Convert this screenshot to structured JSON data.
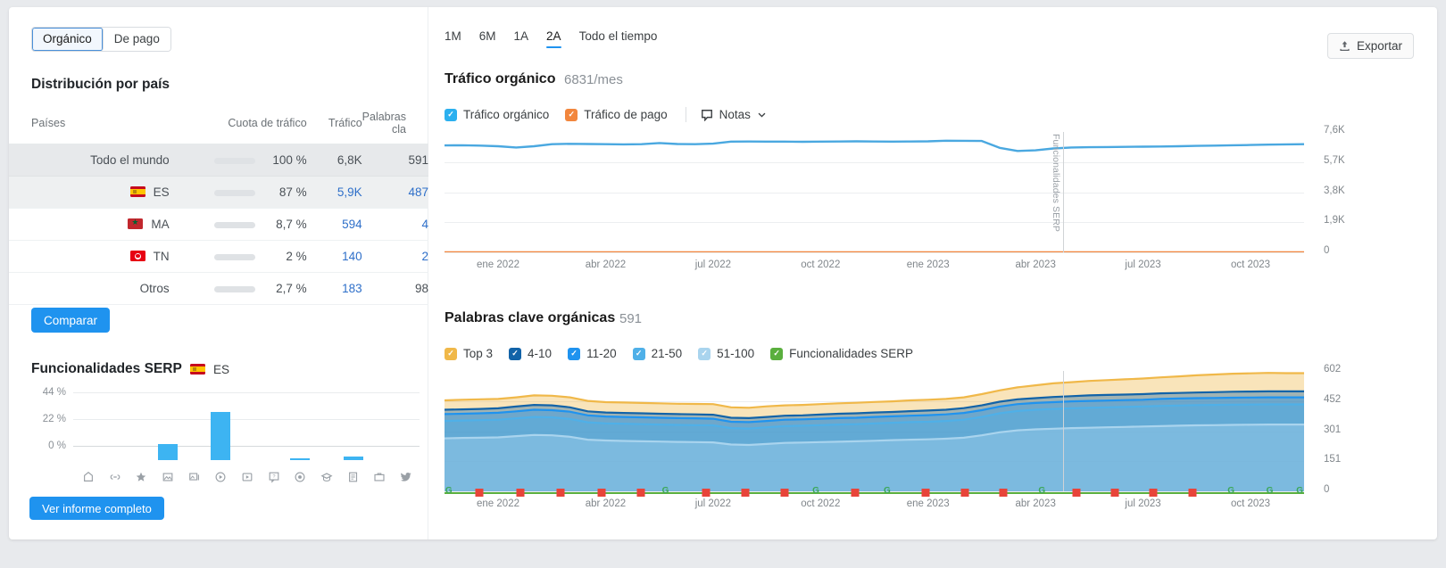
{
  "left_panel": {
    "segmented": {
      "options": [
        {
          "label": "Orgánico",
          "active": true
        },
        {
          "label": "De pago",
          "active": false
        }
      ]
    },
    "distribution": {
      "title": "Distribución por país",
      "columns": [
        "Países",
        "Cuota de tráfico",
        "Tráfico",
        "Palabras cla"
      ],
      "rows": [
        {
          "country": "Todo el mundo",
          "flag": null,
          "share_pct": 100,
          "pct_label": "100 %",
          "traffic": "6,8K",
          "keywords": "591",
          "highlight": "strong"
        },
        {
          "country": "ES",
          "flag": "flag-es",
          "share_pct": 87,
          "pct_label": "87 %",
          "traffic": "5,9K",
          "keywords": "487",
          "highlight": "soft"
        },
        {
          "country": "MA",
          "flag": "flag-ma",
          "share_pct": 8.7,
          "pct_label": "8,7 %",
          "traffic": "594",
          "keywords": "4",
          "highlight": "none"
        },
        {
          "country": "TN",
          "flag": "flag-tn",
          "share_pct": 2,
          "pct_label": "2 %",
          "traffic": "140",
          "keywords": "2",
          "highlight": "none"
        },
        {
          "country": "Otros",
          "flag": null,
          "share_pct": 2.7,
          "pct_label": "2,7 %",
          "traffic": "183",
          "keywords": "98",
          "highlight": "none"
        }
      ]
    },
    "compare_button": "Comparar",
    "serp": {
      "title": "Funcionalidades SERP",
      "country": "ES",
      "full_report_button": "Ver informe completo"
    }
  },
  "right_panel": {
    "periods": [
      {
        "label": "1M",
        "active": false
      },
      {
        "label": "6M",
        "active": false
      },
      {
        "label": "1A",
        "active": false
      },
      {
        "label": "2A",
        "active": true
      },
      {
        "label": "Todo el tiempo",
        "active": false
      }
    ],
    "export_button": "Exportar",
    "traffic": {
      "title": "Tráfico orgánico",
      "subtitle": "6831/mes",
      "legend": [
        {
          "label": "Tráfico orgánico",
          "color": "#2bb0ef",
          "checked": true
        },
        {
          "label": "Tráfico de pago",
          "color": "#f2863d",
          "checked": true
        }
      ],
      "notes_label": "Notas",
      "annotation": "Funcionalidades SERP"
    },
    "keywords": {
      "title": "Palabras clave orgánicas",
      "subtitle": "591",
      "legend": [
        {
          "label": "Top 3",
          "color": "#f0b849",
          "checked": true
        },
        {
          "label": "4-10",
          "color": "#1263a8",
          "checked": true
        },
        {
          "label": "11-20",
          "color": "#1f93ef",
          "checked": true
        },
        {
          "label": "21-50",
          "color": "#4fb0e8",
          "checked": true
        },
        {
          "label": "51-100",
          "color": "#a9d4ee",
          "checked": true
        },
        {
          "label": "Funcionalidades SERP",
          "color": "#5aaf3e",
          "checked": true
        }
      ]
    }
  },
  "chart_data": [
    {
      "type": "bar",
      "id": "serp-features",
      "title": "Funcionalidades SERP",
      "xlabel": "",
      "ylabel": "",
      "ylim": [
        0,
        44
      ],
      "ytick_labels": [
        "44 %",
        "22 %",
        "0 %"
      ],
      "yticks": [
        44,
        22,
        0
      ],
      "categories": [
        "featured-snippet-icon",
        "sitelinks-icon",
        "reviews-icon",
        "image-pack-icon",
        "image-carousel-icon",
        "video-icon",
        "video-carousel-icon",
        "faq-icon",
        "local-pack-icon",
        "knowledge-panel-icon",
        "related-questions-icon",
        "jobs-icon",
        "twitter-icon"
      ],
      "values": [
        0,
        0,
        0,
        13,
        0,
        38,
        0,
        0,
        1.5,
        0,
        3,
        0,
        0
      ],
      "color": "#3db4f2"
    },
    {
      "type": "line",
      "id": "organic-traffic",
      "title": "Tráfico orgánico",
      "subtitle": "6831/mes",
      "xlabel": "",
      "ylabel": "",
      "ylim": [
        0,
        7600
      ],
      "ytick_labels": [
        "7,6K",
        "5,7K",
        "3,8K",
        "1,9K",
        "0"
      ],
      "yticks": [
        7600,
        5700,
        3800,
        1900,
        0
      ],
      "xtick_labels": [
        "ene 2022",
        "abr 2022",
        "jul 2022",
        "oct 2022",
        "ene 2023",
        "abr 2023",
        "jul 2023",
        "oct 2023"
      ],
      "grid": true,
      "legend_position": "top",
      "series": [
        {
          "name": "Tráfico orgánico",
          "color": "#4aa8e0",
          "values": [
            6750,
            6760,
            6740,
            6700,
            6620,
            6700,
            6830,
            6850,
            6840,
            6830,
            6820,
            6830,
            6900,
            6840,
            6830,
            6860,
            6990,
            7000,
            6990,
            6990,
            6980,
            6990,
            7000,
            7010,
            7000,
            6990,
            7000,
            7010,
            7050,
            7040,
            7030,
            6600,
            6400,
            6440,
            6560,
            6620,
            6640,
            6650,
            6660,
            6670,
            6680,
            6700,
            6720,
            6740,
            6760,
            6780,
            6800,
            6820,
            6831
          ]
        },
        {
          "name": "Tráfico de pago",
          "color": "#f2863d",
          "values": [
            0,
            0,
            0,
            0,
            0,
            0,
            0,
            0,
            0,
            0,
            0,
            0,
            0,
            0,
            0,
            0,
            0,
            0,
            0,
            0,
            0,
            0,
            0,
            0,
            0,
            0,
            0,
            0,
            0,
            0,
            0,
            0,
            0,
            0,
            0,
            0,
            0,
            0,
            0,
            0,
            0,
            0,
            0,
            0,
            0,
            0,
            0,
            0,
            0
          ]
        }
      ]
    },
    {
      "type": "area",
      "id": "organic-keywords",
      "title": "Palabras clave orgánicas",
      "subtitle": "591",
      "xlabel": "",
      "ylabel": "",
      "ylim": [
        0,
        602
      ],
      "ytick_labels": [
        "602",
        "452",
        "301",
        "151",
        "0"
      ],
      "yticks": [
        602,
        452,
        301,
        151,
        0
      ],
      "xtick_labels": [
        "ene 2022",
        "abr 2022",
        "jul 2022",
        "oct 2022",
        "ene 2023",
        "abr 2023",
        "jul 2023",
        "oct 2023"
      ],
      "grid": true,
      "legend_position": "top",
      "stacked": true,
      "series": [
        {
          "name": "Top 3",
          "color": "#f0b849",
          "values": [
            455,
            458,
            460,
            462,
            470,
            480,
            478,
            470,
            452,
            446,
            444,
            442,
            440,
            438,
            437,
            436,
            420,
            418,
            425,
            430,
            432,
            436,
            440,
            443,
            447,
            450,
            455,
            458,
            462,
            470,
            486,
            505,
            520,
            530,
            540,
            546,
            552,
            556,
            560,
            564,
            570,
            575,
            580,
            584,
            588,
            590,
            592,
            591,
            591
          ]
        },
        {
          "name": "4-10",
          "color": "#1263a8",
          "values": [
            408,
            410,
            412,
            415,
            424,
            432,
            430,
            420,
            400,
            394,
            392,
            390,
            388,
            386,
            385,
            383,
            368,
            366,
            372,
            378,
            380,
            384,
            388,
            390,
            394,
            397,
            401,
            404,
            408,
            416,
            430,
            448,
            460,
            466,
            472,
            476,
            480,
            482,
            484,
            486,
            490,
            492,
            494,
            496,
            498,
            499,
            500,
            500,
            500
          ]
        },
        {
          "name": "11-20",
          "color": "#1f93ef",
          "values": [
            386,
            388,
            390,
            393,
            400,
            408,
            406,
            398,
            380,
            374,
            372,
            370,
            368,
            366,
            365,
            363,
            348,
            346,
            352,
            358,
            360,
            363,
            366,
            368,
            372,
            375,
            378,
            381,
            385,
            392,
            406,
            424,
            436,
            442,
            446,
            450,
            452,
            454,
            456,
            458,
            462,
            464,
            466,
            467,
            468,
            469,
            470,
            470,
            470
          ]
        },
        {
          "name": "21-50",
          "color": "#4fb0e8",
          "values": [
            352,
            354,
            356,
            358,
            365,
            372,
            370,
            362,
            345,
            340,
            338,
            336,
            334,
            332,
            331,
            330,
            316,
            314,
            320,
            326,
            328,
            331,
            334,
            336,
            340,
            343,
            346,
            348,
            352,
            358,
            372,
            390,
            402,
            408,
            412,
            415,
            418,
            420,
            422,
            424,
            427,
            429,
            431,
            432,
            433,
            434,
            435,
            435,
            435
          ]
        },
        {
          "name": "51-100",
          "color": "#a9d4ee",
          "values": [
            265,
            267,
            268,
            270,
            276,
            282,
            280,
            273,
            258,
            254,
            252,
            250,
            249,
            247,
            246,
            245,
            234,
            232,
            237,
            242,
            244,
            246,
            248,
            250,
            253,
            256,
            258,
            260,
            263,
            268,
            280,
            295,
            305,
            310,
            313,
            316,
            318,
            320,
            322,
            324,
            326,
            328,
            330,
            331,
            332,
            333,
            334,
            334,
            334
          ]
        }
      ],
      "serp_markers": [
        {
          "x_pct": 0.5,
          "type": "g"
        },
        {
          "x_pct": 4.0,
          "type": "red"
        },
        {
          "x_pct": 8.8,
          "type": "red"
        },
        {
          "x_pct": 13.5,
          "type": "red"
        },
        {
          "x_pct": 18.3,
          "type": "red"
        },
        {
          "x_pct": 22.8,
          "type": "red"
        },
        {
          "x_pct": 25.7,
          "type": "g"
        },
        {
          "x_pct": 30.4,
          "type": "red"
        },
        {
          "x_pct": 35.0,
          "type": "red"
        },
        {
          "x_pct": 39.6,
          "type": "red"
        },
        {
          "x_pct": 43.2,
          "type": "g"
        },
        {
          "x_pct": 47.8,
          "type": "red"
        },
        {
          "x_pct": 51.5,
          "type": "g"
        },
        {
          "x_pct": 56.0,
          "type": "red"
        },
        {
          "x_pct": 60.5,
          "type": "red"
        },
        {
          "x_pct": 65.0,
          "type": "red"
        },
        {
          "x_pct": 69.5,
          "type": "g"
        },
        {
          "x_pct": 73.5,
          "type": "red"
        },
        {
          "x_pct": 78.0,
          "type": "red"
        },
        {
          "x_pct": 82.5,
          "type": "red"
        },
        {
          "x_pct": 87.0,
          "type": "red"
        },
        {
          "x_pct": 91.5,
          "type": "g"
        },
        {
          "x_pct": 96.0,
          "type": "g"
        },
        {
          "x_pct": 99.5,
          "type": "g"
        }
      ]
    }
  ]
}
